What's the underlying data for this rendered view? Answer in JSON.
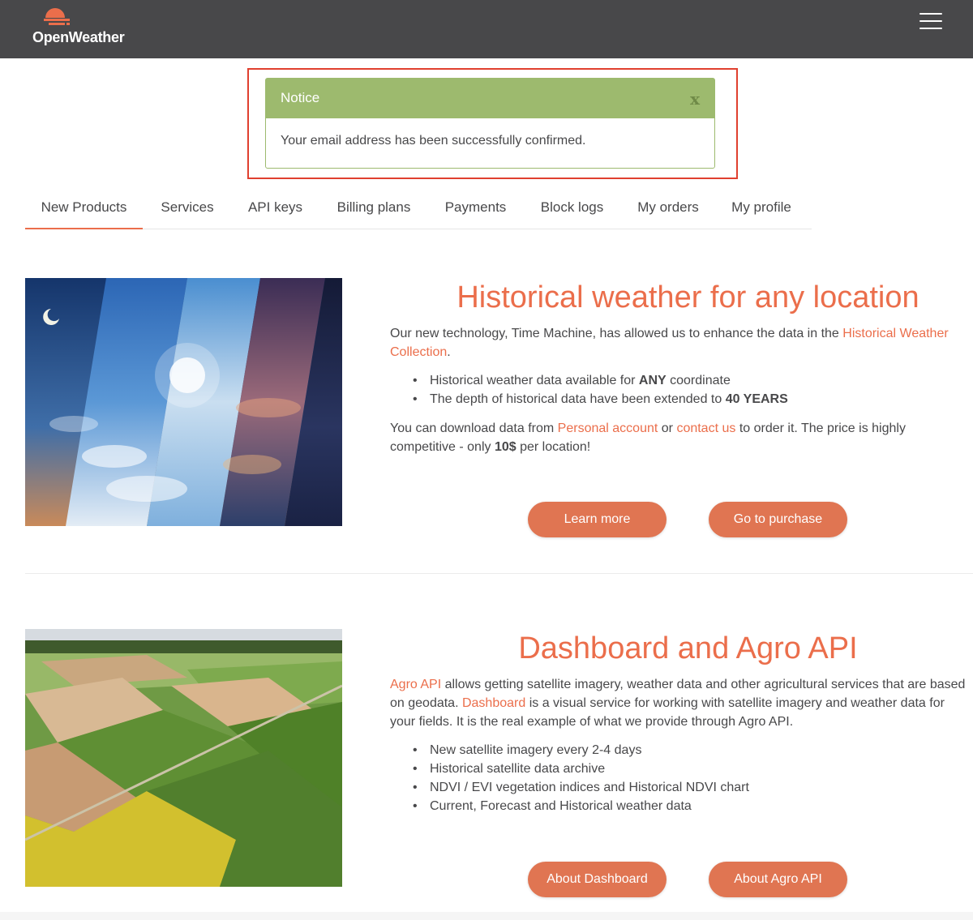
{
  "header": {
    "logo_text": "OpenWeather",
    "menu_icon": "hamburger-menu-icon",
    "bg_color": "#48484a"
  },
  "notice": {
    "title": "Notice",
    "close_label": "x",
    "message": "Your email address has been successfully confirmed.",
    "header_color": "#9dba6e"
  },
  "tabs": [
    {
      "label": "New Products",
      "active": true
    },
    {
      "label": "Services"
    },
    {
      "label": "API keys"
    },
    {
      "label": "Billing plans"
    },
    {
      "label": "Payments"
    },
    {
      "label": "Block logs"
    },
    {
      "label": "My orders"
    },
    {
      "label": "My profile"
    }
  ],
  "section1": {
    "title": "Historical weather for any location",
    "intro_pre": "Our new technology, Time Machine, has allowed us to enhance the data in the ",
    "intro_link": "Historical Weather Collection",
    "intro_post": ".",
    "bullets": [
      {
        "pre": "Historical weather data available for ",
        "bold": "ANY",
        "post": " coordinate"
      },
      {
        "pre": "The depth of historical data have been extended to ",
        "bold": "40 YEARS",
        "post": ""
      }
    ],
    "p2_pre": "You can download data from ",
    "p2_link1": "Personal account",
    "p2_mid": " or ",
    "p2_link2": "contact us",
    "p2_post": " to order it. The price is highly competitive - only ",
    "p2_bold": "10$",
    "p2_end": " per location!",
    "btn_learn": "Learn more",
    "btn_purchase": "Go to purchase"
  },
  "section2": {
    "title": "Dashboard and Agro API",
    "p_link1": "Agro API",
    "p_text1": " allows getting satellite imagery, weather data and other agricultural services that are based on geodata. ",
    "p_link2": "Dashboard",
    "p_text2": " is a visual service for working with satellite imagery and weather data for your fields. It is the real example of what we provide through Agro API.",
    "bullets": [
      "New satellite imagery every 2-4 days",
      "Historical satellite data archive",
      "NDVI / EVI vegetation indices and Historical NDVI chart",
      "Current, Forecast and Historical weather data"
    ],
    "btn_dashboard": "About Dashboard",
    "btn_agro": "About Agro API"
  },
  "colors": {
    "accent": "#eb6e4b",
    "button": "#e07552",
    "notice_border": "#e0402f"
  }
}
